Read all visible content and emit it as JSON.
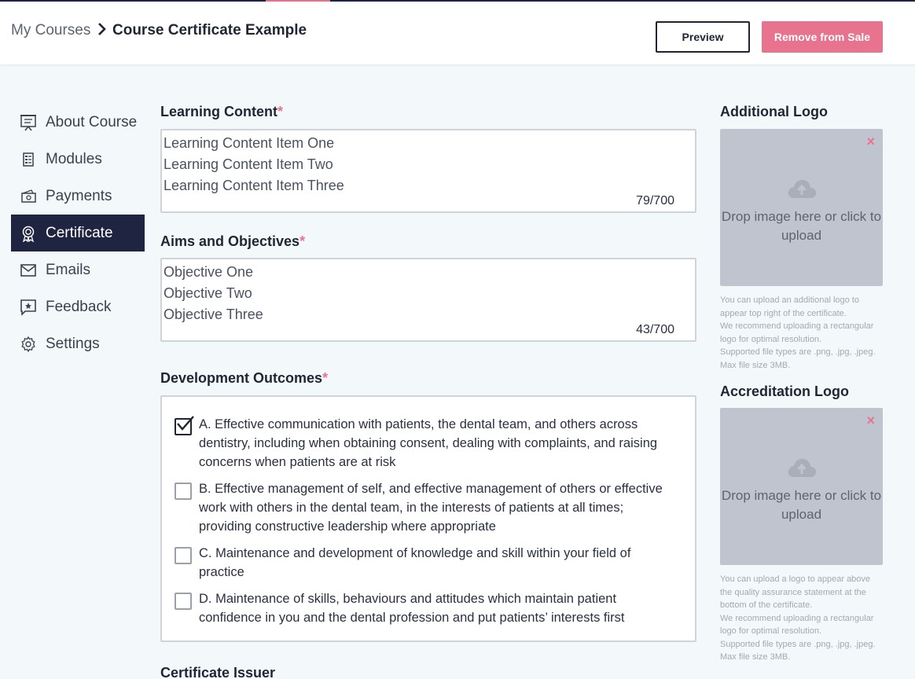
{
  "breadcrumb": {
    "root": "My Courses",
    "current": "Course Certificate Example"
  },
  "header": {
    "preview_label": "Preview",
    "remove_label": "Remove from Sale"
  },
  "sidebar": {
    "items": [
      {
        "label": "About Course",
        "icon": "presentation-board-icon"
      },
      {
        "label": "Modules",
        "icon": "list-document-icon"
      },
      {
        "label": "Payments",
        "icon": "banknote-icon"
      },
      {
        "label": "Certificate",
        "icon": "award-ribbon-icon",
        "active": true
      },
      {
        "label": "Emails",
        "icon": "envelope-icon"
      },
      {
        "label": "Feedback",
        "icon": "chat-star-icon"
      },
      {
        "label": "Settings",
        "icon": "gear-icon"
      }
    ]
  },
  "learning_content": {
    "label": "Learning Content",
    "required_mark": "*",
    "lines": [
      "Learning Content Item One",
      "Learning Content Item Two",
      "Learning Content Item Three"
    ],
    "counter": "79/700"
  },
  "aims": {
    "label": "Aims and Objectives",
    "required_mark": "*",
    "lines": [
      "Objective One",
      "Objective Two",
      "Objective Three"
    ],
    "counter": "43/700"
  },
  "outcomes": {
    "label": "Development Outcomes",
    "required_mark": "*",
    "items": [
      {
        "text": "A. Effective communication with patients, the dental team, and others across dentistry, including when obtaining consent, dealing with complaints, and raising concerns when patients are at risk",
        "checked": true
      },
      {
        "text": "B. Effective management of self, and effective management of others or effective work with others in the dental team, in the interests of patients at all times; providing constructive leadership where appropriate",
        "checked": false
      },
      {
        "text": "C. Maintenance and development of knowledge and skill within your field of practice",
        "checked": false
      },
      {
        "text": "D. Maintenance of skills, behaviours and attitudes which maintain patient confidence in you and the dental profession and put patients’ interests first",
        "checked": false
      }
    ]
  },
  "certificate_issuer": {
    "label": "Certificate Issuer"
  },
  "additional_logo": {
    "label": "Additional Logo",
    "drop_text": "Drop image here or click to upload",
    "close": "×",
    "note": [
      "You can upload an additional logo to appear top right of the certificate.",
      "We recommend uploading a rectangular logo for optimal resolution.",
      "Supported file types are .png, .jpg, .jpeg. Max file size 3MB."
    ]
  },
  "accreditation_logo": {
    "label": "Accreditation Logo",
    "drop_text": "Drop image here or click to upload",
    "close": "×",
    "note": [
      "You can upload a logo to appear above the quality assurance statement at the bottom of the certificate.",
      "We recommend uploading a rectangular logo for optimal resolution.",
      "Supported file types are .png, .jpg, .jpeg. Max file size 3MB."
    ]
  },
  "colors": {
    "accent": "#e8738f",
    "nav_active": "#1f2540",
    "dropzone": "#c0c4ce"
  }
}
